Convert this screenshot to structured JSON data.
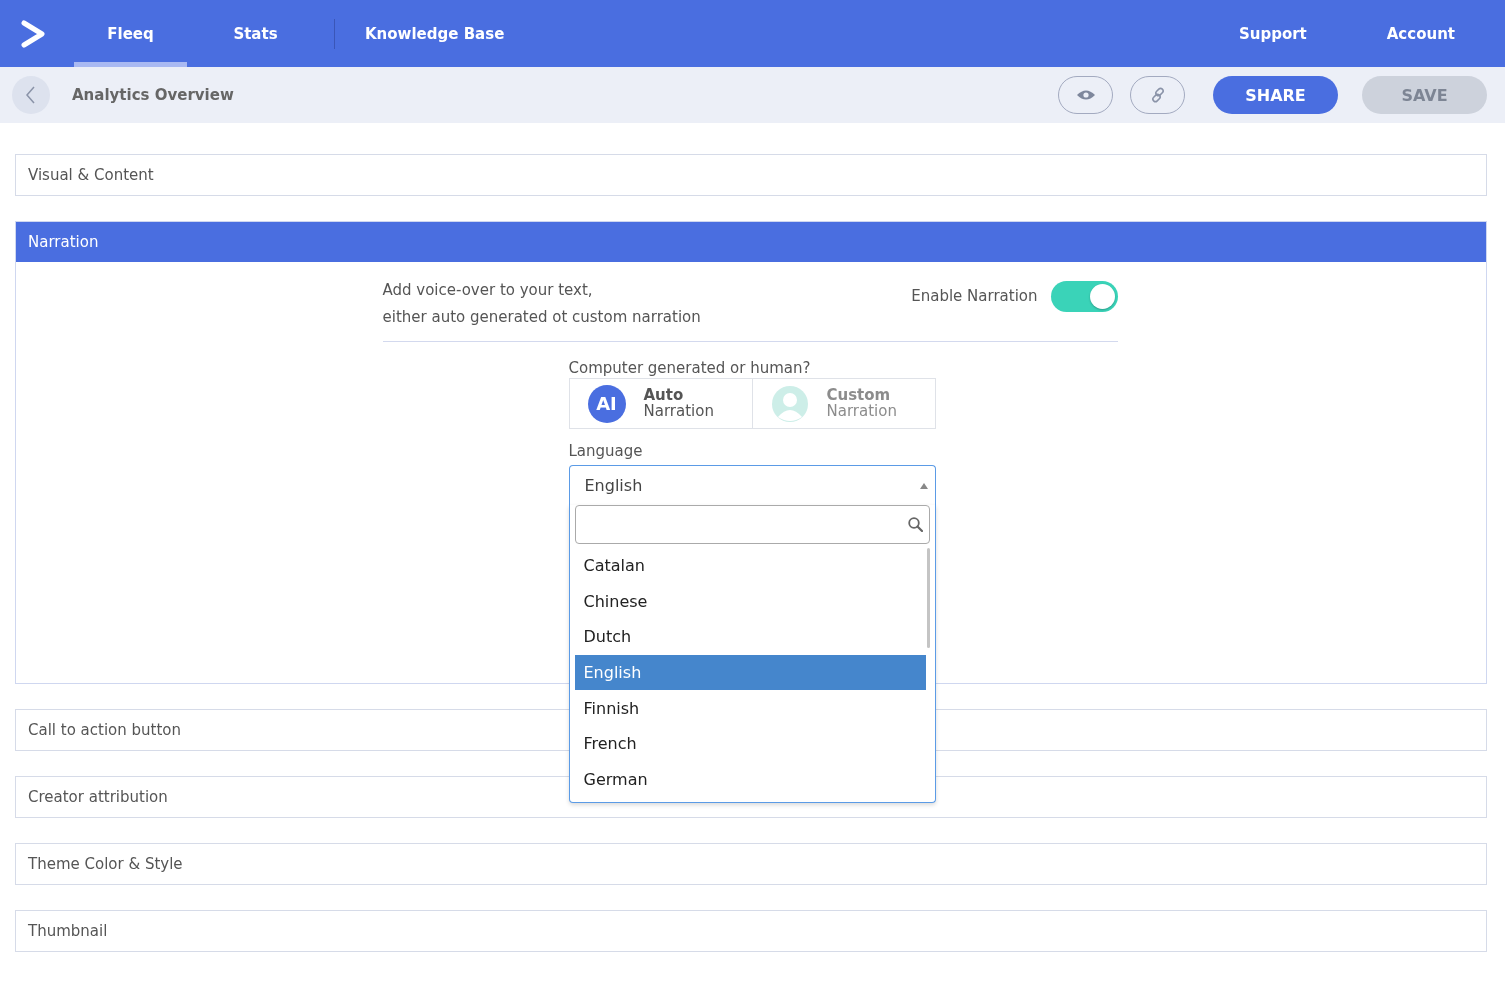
{
  "nav": {
    "tabs": [
      {
        "label": "Fleeq",
        "selected": true
      },
      {
        "label": "Stats",
        "selected": false
      },
      {
        "label": "Knowledge Base",
        "selected": false
      }
    ],
    "right_links": [
      "Support",
      "Account"
    ]
  },
  "toolbar": {
    "title": "Analytics Overview",
    "share_label": "SHARE",
    "save_label": "SAVE",
    "save_disabled": true
  },
  "sections": [
    {
      "title": "Visual & Content",
      "expanded": false
    },
    {
      "title": "Narration",
      "expanded": true
    },
    {
      "title": "Call to action button",
      "expanded": false
    },
    {
      "title": "Creator attribution",
      "expanded": false
    },
    {
      "title": "Theme Color & Style",
      "expanded": false
    },
    {
      "title": "Thumbnail",
      "expanded": false
    }
  ],
  "narration": {
    "description": [
      "Add voice-over to your text,",
      "either auto generated ot custom narration"
    ],
    "toggle_label": "Enable Narration",
    "enabled": true,
    "question": "Computer generated or human?",
    "options": [
      {
        "kind": "ai",
        "badge": "AI",
        "title": "Auto",
        "subtitle": "Narration",
        "selected": true
      },
      {
        "kind": "person",
        "title": "Custom",
        "subtitle": "Narration",
        "selected": false
      }
    ],
    "language_label": "Language",
    "language_value": "English",
    "dropdown_open": true,
    "languages": [
      {
        "label": "Catalan",
        "selected": false
      },
      {
        "label": "Chinese",
        "selected": false
      },
      {
        "label": "Dutch",
        "selected": false
      },
      {
        "label": "English",
        "selected": true
      },
      {
        "label": "Finnish",
        "selected": false
      },
      {
        "label": "French",
        "selected": false
      },
      {
        "label": "German",
        "selected": false
      }
    ]
  }
}
